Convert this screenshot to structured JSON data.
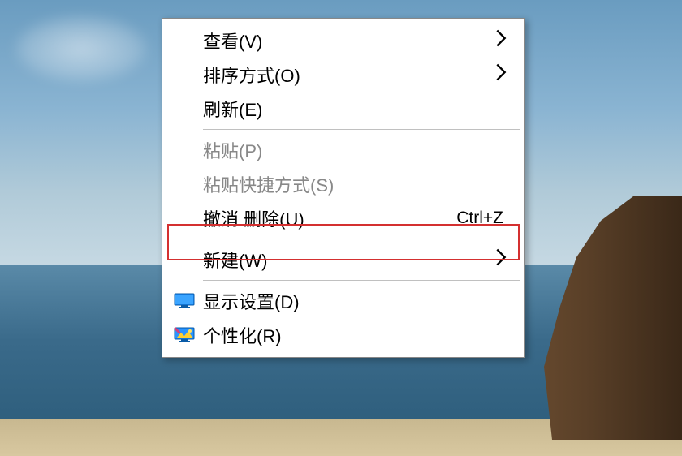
{
  "menu": {
    "items": [
      {
        "label": "查看(V)",
        "hasSubmenu": true
      },
      {
        "label": "排序方式(O)",
        "hasSubmenu": true
      },
      {
        "label": "刷新(E)"
      },
      {
        "label": "粘贴(P)",
        "disabled": true
      },
      {
        "label": "粘贴快捷方式(S)",
        "disabled": true
      },
      {
        "label": "撤消 删除(U)",
        "shortcut": "Ctrl+Z",
        "highlighted": true
      },
      {
        "label": "新建(W)",
        "hasSubmenu": true
      },
      {
        "label": "显示设置(D)",
        "icon": "display"
      },
      {
        "label": "个性化(R)",
        "icon": "personalize"
      }
    ]
  },
  "highlight": {
    "color": "#d43030"
  }
}
